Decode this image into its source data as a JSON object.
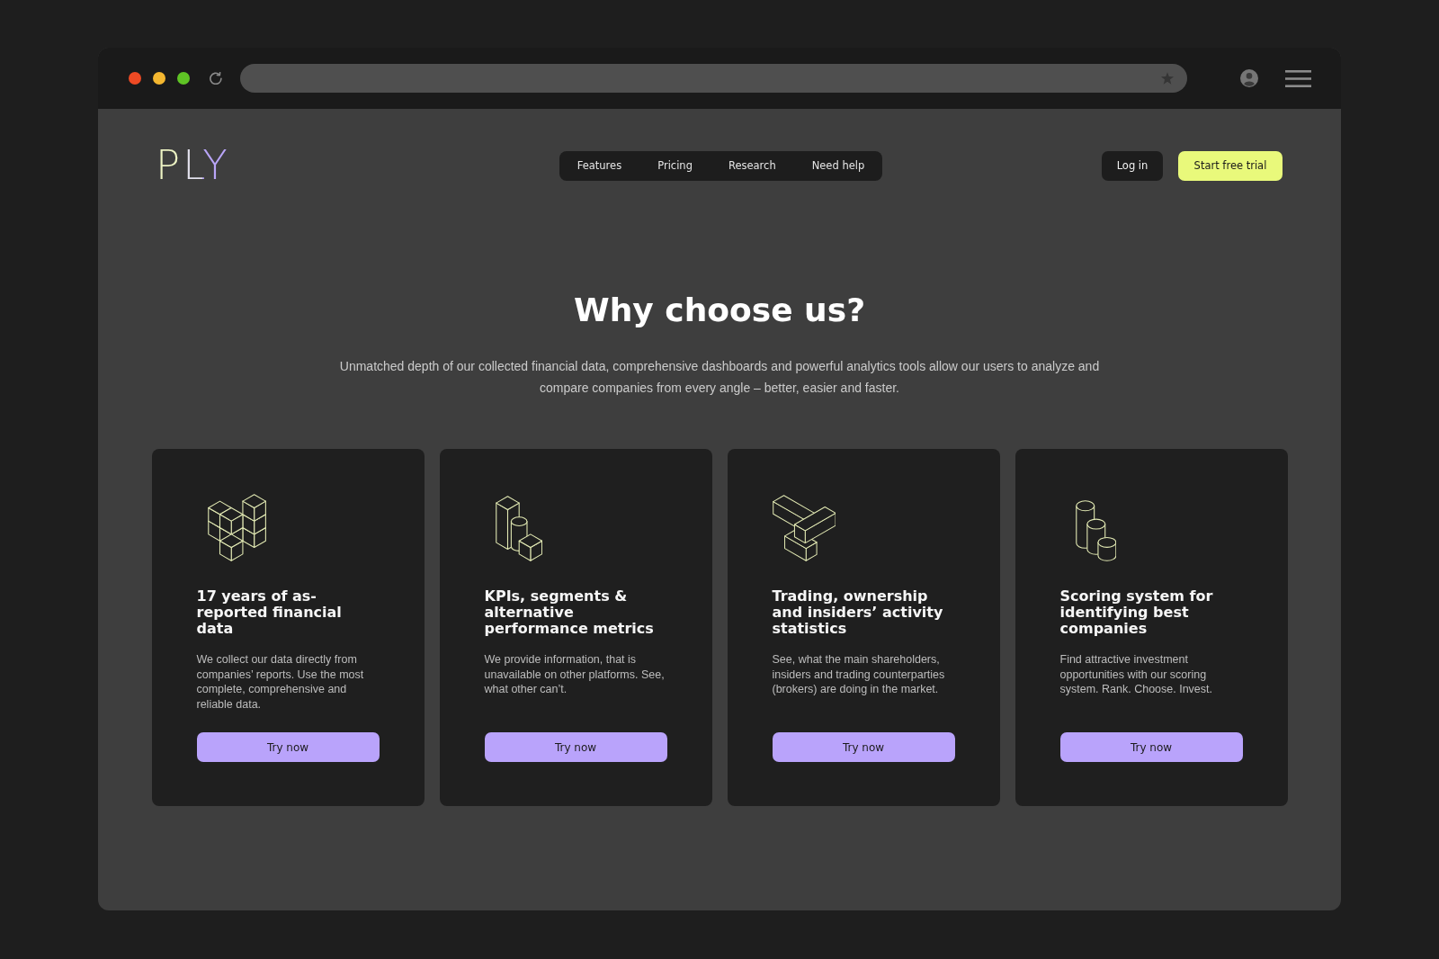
{
  "header": {
    "logo": "PLY",
    "nav": [
      {
        "label": "Features"
      },
      {
        "label": "Pricing"
      },
      {
        "label": "Research"
      },
      {
        "label": "Need help"
      }
    ],
    "login": "Log in",
    "cta": "Start free trial"
  },
  "hero": {
    "title": "Why choose us?",
    "text": "Unmatched depth of our collected financial data, comprehensive dashboards and powerful analytics tools allow our users to analyze and compare companies from every angle – better, easier and faster."
  },
  "cards": [
    {
      "title": "17 years of as-reported financial data",
      "text": "We collect our data directly from companies’ reports. Use the most complete, comprehensive and reliable data.",
      "button": "Try now"
    },
    {
      "title": "KPIs, segments & alternative performance metrics",
      "text": "We provide information, that is unavailable on other platforms. See, what other can’t.",
      "button": "Try now"
    },
    {
      "title": "Trading, ownership and insiders’ activity statistics",
      "text": "See, what the main shareholders, insiders and trading counterparties (brokers) are doing in the market.",
      "button": "Try now"
    },
    {
      "title": "Scoring system for identifying best companies",
      "text": "Find attractive investment opportunities with our scoring system. Rank. Choose. Invest.",
      "button": "Try now"
    }
  ]
}
